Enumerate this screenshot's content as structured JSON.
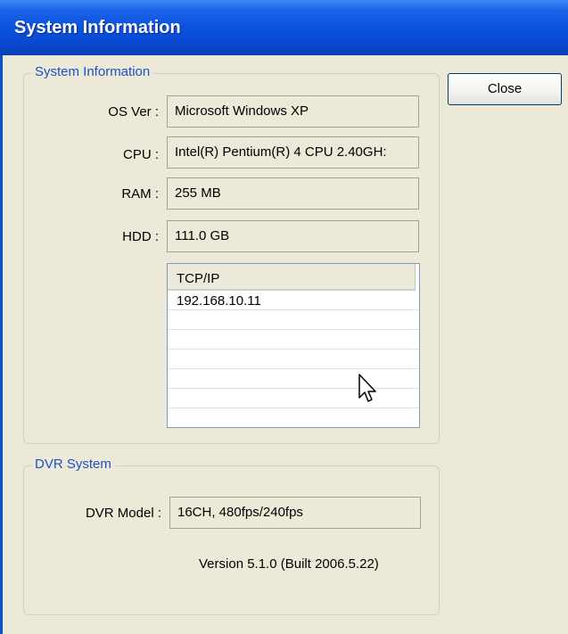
{
  "window": {
    "title": "System Information"
  },
  "close_label": "Close",
  "system_info": {
    "legend": "System Information",
    "os_label": "OS Ver :",
    "os_value": "Microsoft Windows XP",
    "cpu_label": "CPU :",
    "cpu_value": "Intel(R) Pentium(R) 4 CPU 2.40GH:",
    "ram_label": "RAM :",
    "ram_value": "255 MB",
    "hdd_label": "HDD :",
    "hdd_value": "111.0 GB",
    "tcpip": {
      "column_header": "TCP/IP",
      "rows": [
        "192.168.10.11",
        "",
        "",
        "",
        "",
        "",
        ""
      ]
    }
  },
  "dvr_system": {
    "legend": "DVR System",
    "model_label": "DVR Model :",
    "model_value": "16CH, 480fps/240fps",
    "version_text": "Version 5.1.0 (Built 2006.5.22)"
  },
  "icons": {
    "cursor": "arrow-cursor-icon"
  }
}
